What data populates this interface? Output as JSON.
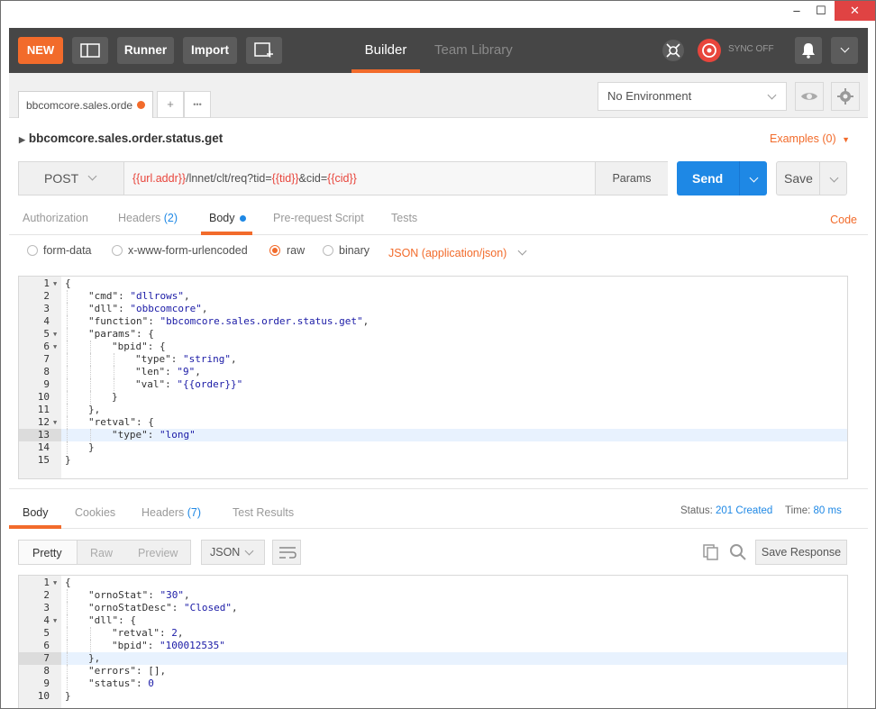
{
  "window": {
    "controls": {
      "minimize": "‒",
      "maximize": "☐",
      "close": "✕"
    }
  },
  "toolbar": {
    "new_label": "NEW",
    "runner_label": "Runner",
    "import_label": "Import",
    "builder_label": "Builder",
    "team_library_label": "Team Library",
    "sync_label": "SYNC OFF",
    "accent": "#f26b2b"
  },
  "tabs": {
    "request_tab_label": "bbcomcore.sales.orde",
    "add_label": "+",
    "more_label": "•••"
  },
  "environment": {
    "selected": "No Environment"
  },
  "request": {
    "name": "bbcomcore.sales.order.status.get",
    "examples_label": "Examples (0)",
    "method": "POST",
    "url_parts": [
      {
        "text": "{{url.addr}}",
        "var": true
      },
      {
        "text": "/lnnet/clt/req?tid=",
        "var": false
      },
      {
        "text": "{{tid}}",
        "var": true
      },
      {
        "text": "&cid=",
        "var": false
      },
      {
        "text": "{{cid}}",
        "var": true
      }
    ],
    "params_label": "Params",
    "send_label": "Send",
    "save_label": "Save"
  },
  "request_tabs": {
    "authorization": "Authorization",
    "headers": "Headers",
    "headers_count": "(2)",
    "body": "Body",
    "prerequest": "Pre-request Script",
    "tests": "Tests",
    "code": "Code"
  },
  "body_types": {
    "form_data": "form-data",
    "urlencoded": "x-www-form-urlencoded",
    "raw": "raw",
    "binary": "binary",
    "content_type": "JSON (application/json)",
    "selected": "raw"
  },
  "request_body": {
    "lines": [
      {
        "n": "1",
        "fold": true,
        "indent": 0,
        "text": "{"
      },
      {
        "n": "2",
        "fold": false,
        "indent": 1,
        "text": "\"cmd\": \"dllrows\","
      },
      {
        "n": "3",
        "fold": false,
        "indent": 1,
        "text": "\"dll\": \"obbcomcore\","
      },
      {
        "n": "4",
        "fold": false,
        "indent": 1,
        "text": "\"function\": \"bbcomcore.sales.order.status.get\","
      },
      {
        "n": "5",
        "fold": true,
        "indent": 1,
        "text": "\"params\": {"
      },
      {
        "n": "6",
        "fold": true,
        "indent": 2,
        "text": "\"bpid\": {"
      },
      {
        "n": "7",
        "fold": false,
        "indent": 3,
        "text": "\"type\": \"string\","
      },
      {
        "n": "8",
        "fold": false,
        "indent": 3,
        "text": "\"len\": \"9\","
      },
      {
        "n": "9",
        "fold": false,
        "indent": 3,
        "text": "\"val\": \"{{order}}\""
      },
      {
        "n": "10",
        "fold": false,
        "indent": 2,
        "text": "}"
      },
      {
        "n": "11",
        "fold": false,
        "indent": 1,
        "text": "},"
      },
      {
        "n": "12",
        "fold": true,
        "indent": 1,
        "text": "\"retval\": {"
      },
      {
        "n": "13",
        "fold": false,
        "indent": 2,
        "text": "\"type\": \"long\"",
        "highlight": true
      },
      {
        "n": "14",
        "fold": false,
        "indent": 1,
        "text": "}"
      },
      {
        "n": "15",
        "fold": false,
        "indent": 0,
        "text": "}"
      }
    ]
  },
  "response": {
    "tabs": {
      "body": "Body",
      "cookies": "Cookies",
      "headers": "Headers",
      "headers_count": "(7)",
      "test_results": "Test Results"
    },
    "status_label": "Status:",
    "status_value": "201 Created",
    "time_label": "Time:",
    "time_value": "80 ms",
    "view_modes": {
      "pretty": "Pretty",
      "raw": "Raw",
      "preview": "Preview"
    },
    "format": "JSON",
    "save_response_label": "Save Response",
    "lines": [
      {
        "n": "1",
        "fold": true,
        "indent": 0,
        "text": "{"
      },
      {
        "n": "2",
        "fold": false,
        "indent": 1,
        "text": "\"ornoStat\": \"30\","
      },
      {
        "n": "3",
        "fold": false,
        "indent": 1,
        "text": "\"ornoStatDesc\": \"Closed\","
      },
      {
        "n": "4",
        "fold": true,
        "indent": 1,
        "text": "\"dll\": {"
      },
      {
        "n": "5",
        "fold": false,
        "indent": 2,
        "text": "\"retval\": 2,"
      },
      {
        "n": "6",
        "fold": false,
        "indent": 2,
        "text": "\"bpid\": \"100012535\""
      },
      {
        "n": "7",
        "fold": false,
        "indent": 1,
        "text": "},",
        "highlight": true
      },
      {
        "n": "8",
        "fold": false,
        "indent": 1,
        "text": "\"errors\": [],"
      },
      {
        "n": "9",
        "fold": false,
        "indent": 1,
        "text": "\"status\": 0"
      },
      {
        "n": "10",
        "fold": false,
        "indent": 0,
        "text": "}"
      }
    ]
  }
}
